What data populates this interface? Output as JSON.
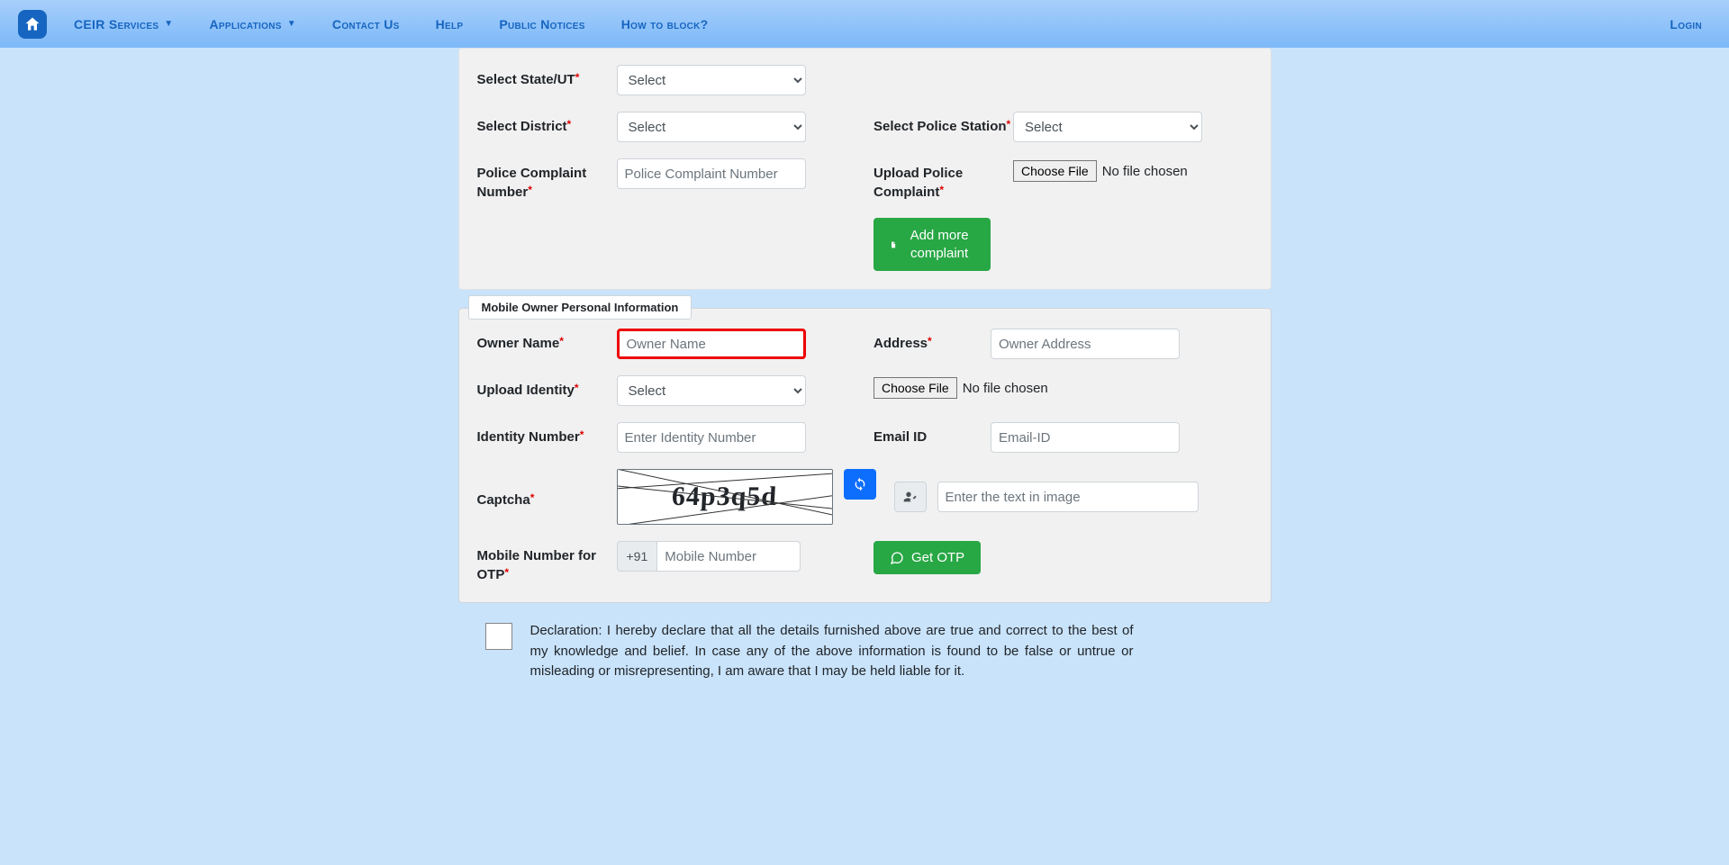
{
  "nav": {
    "ceir_services": "CEIR Services",
    "applications": "Applications",
    "contact_us": "Contact Us",
    "help": "Help",
    "public_notices": "Public Notices",
    "how_to_block": "How to block?",
    "login": "Login"
  },
  "section1": {
    "state_label": "Select State/UT",
    "state_default": "Select",
    "district_label": "Select District",
    "district_default": "Select",
    "police_station_label": "Select Police Station",
    "police_station_default": "Select",
    "complaint_no_label": "Police Complaint Number",
    "complaint_no_placeholder": "Police Complaint Number",
    "upload_complaint_label": "Upload Police Complaint",
    "choose_file": "Choose File",
    "no_file": "No file chosen",
    "add_more": "Add more complaint"
  },
  "section2": {
    "legend": "Mobile Owner Personal Information",
    "owner_name_label": "Owner Name",
    "owner_name_placeholder": "Owner Name",
    "address_label": "Address",
    "address_placeholder": "Owner Address",
    "upload_identity_label": "Upload Identity",
    "identity_default": "Select",
    "choose_file": "Choose File",
    "no_file": "No file chosen",
    "identity_no_label": "Identity Number",
    "identity_no_placeholder": "Enter Identity Number",
    "email_label": "Email ID",
    "email_placeholder": "Email-ID",
    "captcha_label": "Captcha",
    "captcha_text": "64p3q5d",
    "captcha_placeholder": "Enter the text in image",
    "otp_label": "Mobile Number for OTP",
    "otp_prefix": "+91",
    "otp_placeholder": "Mobile Number",
    "get_otp": "Get OTP"
  },
  "declaration": {
    "text": "Declaration: I hereby declare that all the details furnished above are true and correct to the best of my knowledge and belief. In case any of the above information is found to be false or untrue or misleading or misrepresenting, I am aware that I may be held liable for it."
  }
}
